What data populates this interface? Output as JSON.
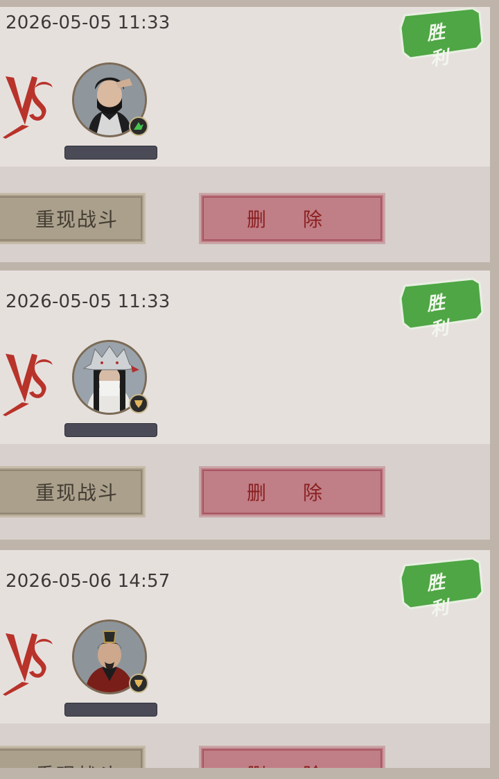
{
  "records": [
    {
      "timestamp": "2026-05-05 11:33",
      "result_label": "胜 利",
      "replay_label": "重现战斗",
      "delete_label": "删 除",
      "rank_icon": "green-rank-icon",
      "avatar": "masked-warrior-avatar"
    },
    {
      "timestamp": "2026-05-05 11:33",
      "result_label": "胜 利",
      "replay_label": "重现战斗",
      "delete_label": "删 除",
      "rank_icon": "gold-rank-icon",
      "avatar": "dragon-helm-warrior-avatar"
    },
    {
      "timestamp": "2026-05-06 14:57",
      "result_label": "胜 利",
      "replay_label": "重现战斗",
      "delete_label": "删 除",
      "rank_icon": "gold-rank-icon",
      "avatar": "noble-general-avatar"
    }
  ],
  "colors": {
    "victory_green": "#4ea644",
    "delete_red": "#c07e86",
    "vs_red": "#b8332a"
  }
}
